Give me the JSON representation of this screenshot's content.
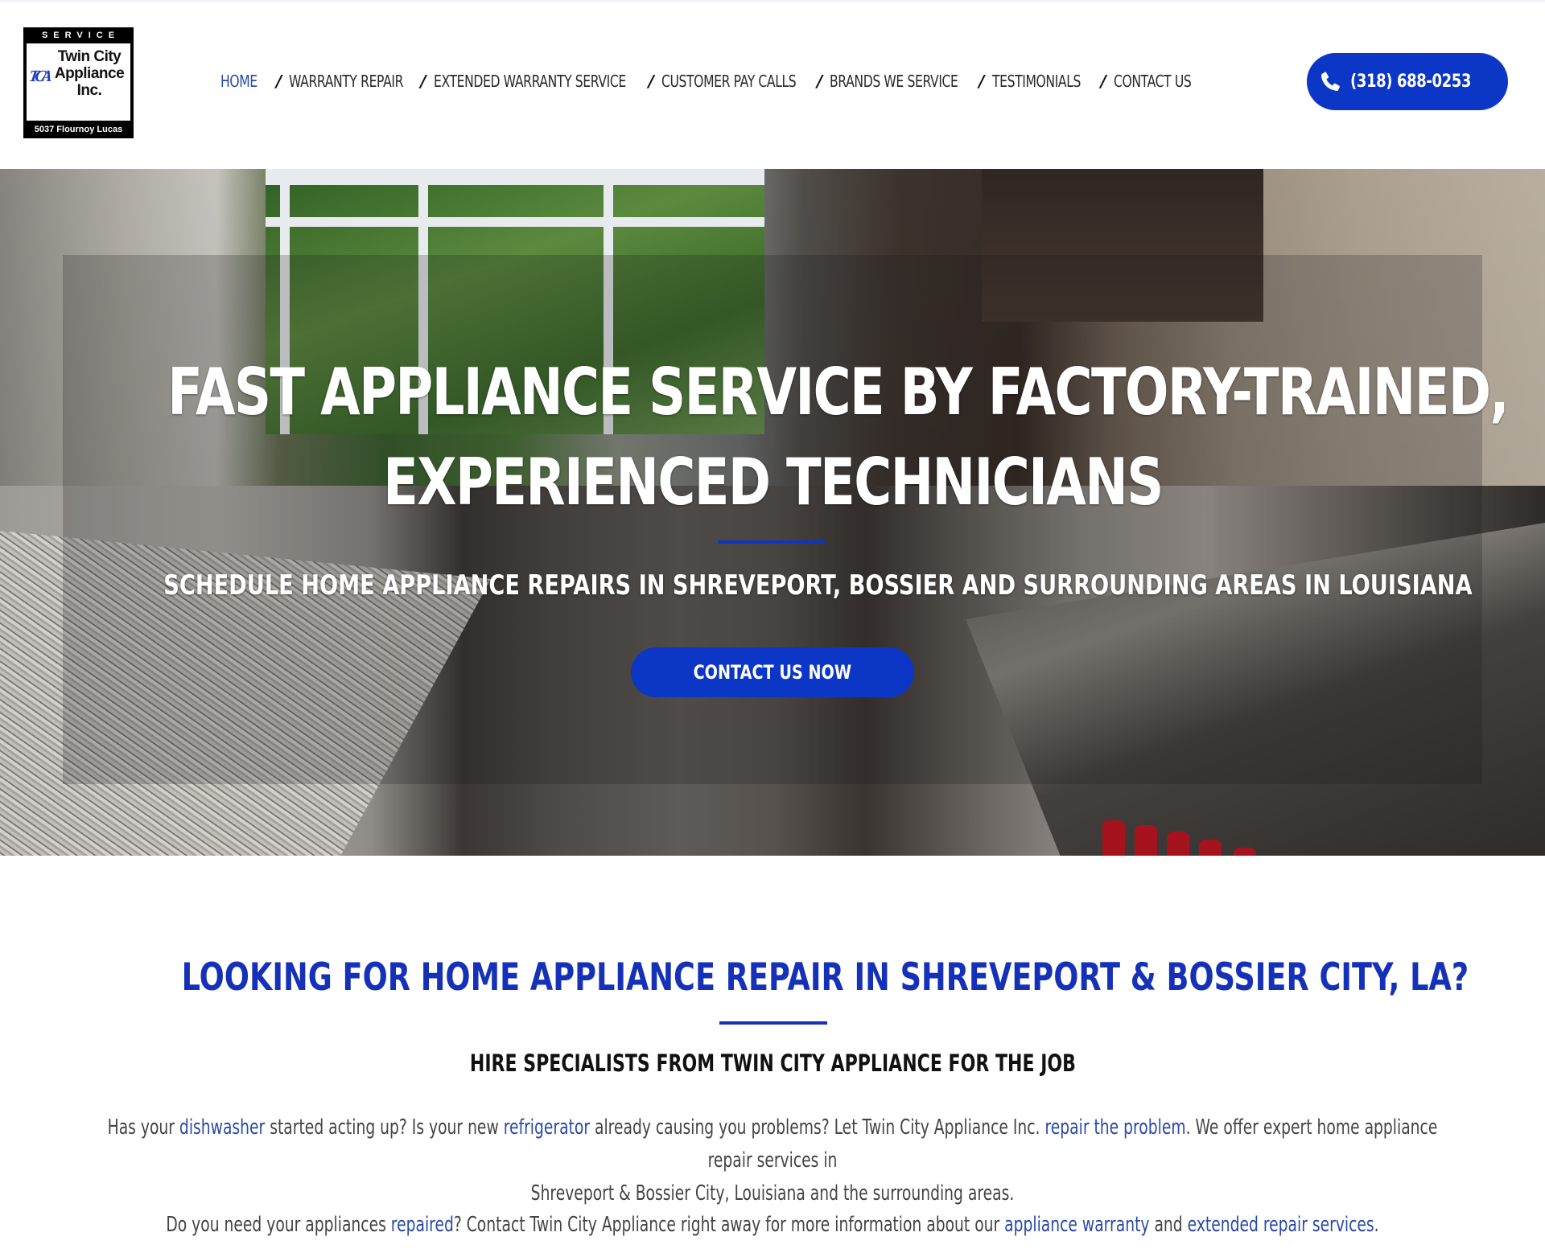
{
  "logo": {
    "top_text": "SERVICE",
    "monogram": "TCA",
    "name_line1": "Twin City",
    "name_line2": "Appliance",
    "name_line3": "Inc.",
    "address": "5037 Flournoy Lucas"
  },
  "nav": {
    "items": [
      {
        "label": "HOME",
        "active": true
      },
      {
        "label": "WARRANTY REPAIR",
        "active": false
      },
      {
        "label": "EXTENDED WARRANTY SERVICE",
        "active": false
      },
      {
        "label": "CUSTOMER PAY CALLS",
        "active": false
      },
      {
        "label": "BRANDS WE SERVICE",
        "active": false
      },
      {
        "label": "TESTIMONIALS",
        "active": false
      },
      {
        "label": "CONTACT US",
        "active": false
      }
    ],
    "separator": "/"
  },
  "phone_button": {
    "icon": "phone-icon",
    "label": "(318) 688-0253"
  },
  "hero": {
    "title_line1": "FAST APPLIANCE SERVICE BY FACTORY-TRAINED,",
    "title_line2": "EXPERIENCED TECHNICIANS",
    "subtitle": "SCHEDULE HOME APPLIANCE REPAIRS IN SHREVEPORT, BOSSIER AND SURROUNDING AREAS IN LOUISIANA",
    "cta_label": "CONTACT US NOW"
  },
  "intro": {
    "title": "LOOKING FOR HOME APPLIANCE REPAIR IN SHREVEPORT & BOSSIER CITY, LA?",
    "subtitle": "HIRE SPECIALISTS FROM TWIN CITY APPLIANCE FOR THE JOB",
    "paragraph1": {
      "t1": "Has your ",
      "link1": "dishwasher",
      "t2": " started acting up? Is your new ",
      "link2": "refrigerator",
      "t3": " already causing you problems? Let Twin City Appliance Inc. ",
      "link3": "repair the problem",
      "t4": ". We offer expert home appliance repair services in",
      "t5": "Shreveport & Bossier City, Louisiana and the surrounding areas."
    },
    "paragraph2": {
      "t1": "Do you need your appliances ",
      "link1": "repaired",
      "t2": "? Contact Twin City Appliance right away for more information about our ",
      "link2": "appliance warranty",
      "t3": " and ",
      "link3": "extended repair services",
      "t4": "."
    }
  },
  "colors": {
    "brand_blue": "#0c36c6",
    "heading_blue": "#1531b8",
    "link_blue": "#2a4aa8",
    "nav_text": "#2a2a2a",
    "body_text": "#444444"
  }
}
